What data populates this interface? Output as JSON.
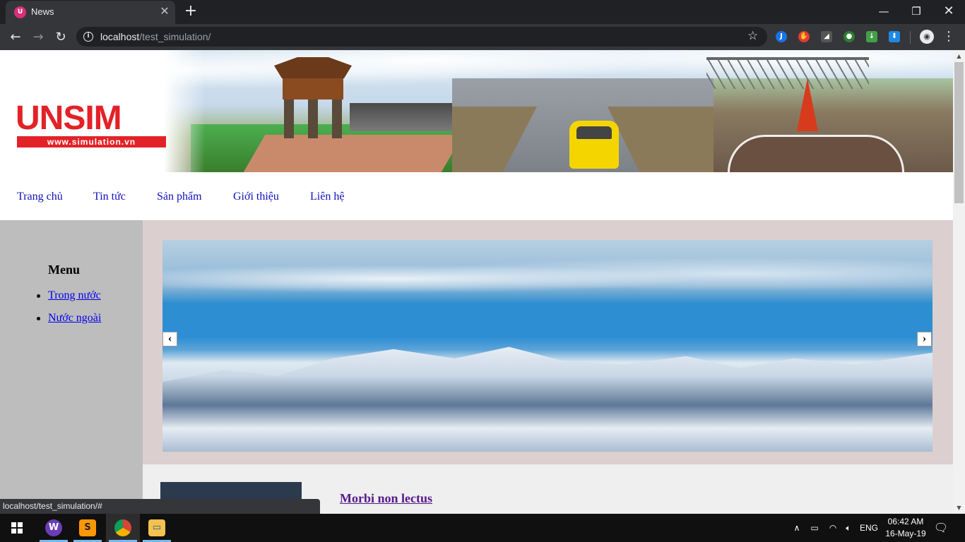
{
  "browser": {
    "tab_title": "News",
    "tab_icon": "unsim-favicon",
    "url_host": "localhost",
    "url_path": "/test_simulation/",
    "status_url": "localhost/test_simulation/#"
  },
  "site": {
    "logo": {
      "text": "UNSIM",
      "url": "www.simulation.vn",
      "brand_color": "#e32228"
    },
    "nav": {
      "items": [
        {
          "label": "Trang chủ"
        },
        {
          "label": "Tin tức"
        },
        {
          "label": "Sản phẩm"
        },
        {
          "label": "Giới thiệu"
        },
        {
          "label": "Liên hệ"
        }
      ]
    },
    "sidebar": {
      "title": "Menu",
      "items": [
        {
          "label": "Trong nước"
        },
        {
          "label": "Nước ngoài"
        }
      ]
    },
    "slider": {
      "prev_label": "‹",
      "next_label": "›"
    },
    "article": {
      "title": "Morbi non lectus"
    }
  },
  "taskbar": {
    "language": "ENG",
    "time": "06:42 AM",
    "date": "16-May-19"
  }
}
